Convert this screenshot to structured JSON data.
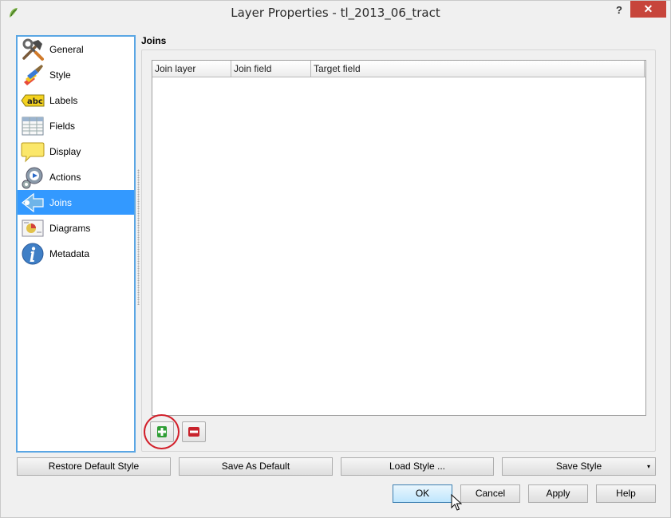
{
  "window": {
    "title": "Layer Properties - tl_2013_06_tract",
    "help_label": "?",
    "close_label": "✕"
  },
  "sidebar": {
    "items": [
      {
        "label": "General",
        "icon": "hammer-wrench-icon"
      },
      {
        "label": "Style",
        "icon": "paintbrush-icon"
      },
      {
        "label": "Labels",
        "icon": "abc-label-icon"
      },
      {
        "label": "Fields",
        "icon": "table-fields-icon"
      },
      {
        "label": "Display",
        "icon": "speech-bubble-icon"
      },
      {
        "label": "Actions",
        "icon": "gear-play-icon"
      },
      {
        "label": "Joins",
        "icon": "join-arrow-icon",
        "selected": true
      },
      {
        "label": "Diagrams",
        "icon": "diagram-chart-icon"
      },
      {
        "label": "Metadata",
        "icon": "info-icon"
      }
    ]
  },
  "joins": {
    "section_title": "Joins",
    "columns": [
      "Join layer",
      "Join field",
      "Target field"
    ],
    "rows": []
  },
  "style_buttons": {
    "restore": "Restore Default Style",
    "save_default": "Save As Default",
    "load": "Load Style ...",
    "save_style": "Save Style",
    "save_style_arrow": "▾"
  },
  "dialog_buttons": {
    "ok": "OK",
    "cancel": "Cancel",
    "apply": "Apply",
    "help": "Help"
  },
  "colors": {
    "selection": "#3399ff",
    "highlight_ring": "#d21f2a",
    "close_button": "#c7453b",
    "add_green": "#2e9e35",
    "remove_red": "#c8232c"
  }
}
